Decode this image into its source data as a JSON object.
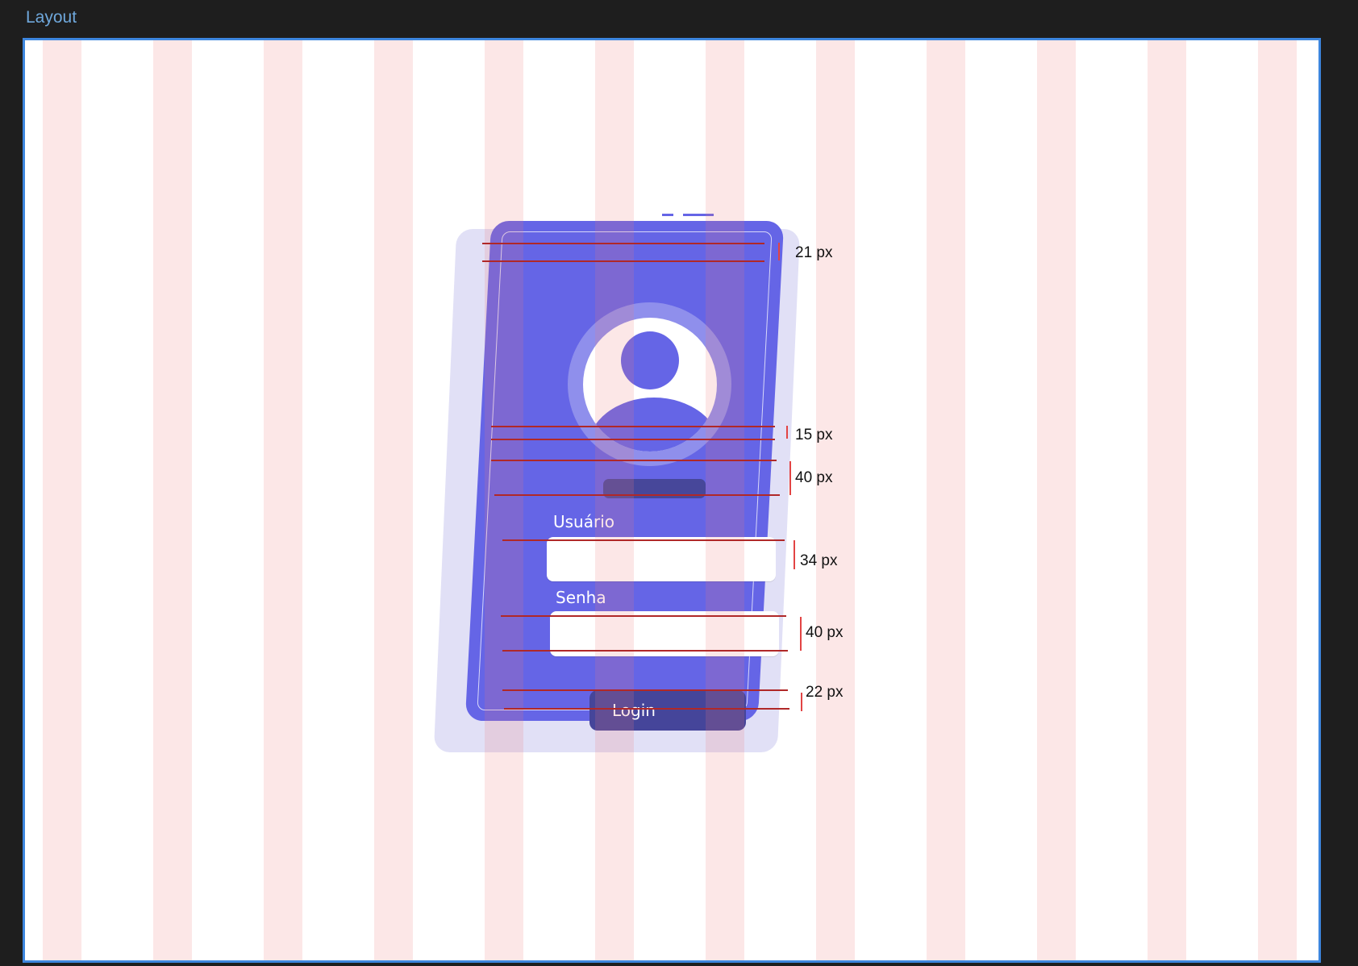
{
  "frame": {
    "title": "Layout"
  },
  "login_card": {
    "user_label": "Usuário",
    "password_label": "Senha",
    "login_label": "Login",
    "user_value": "",
    "password_value": ""
  },
  "measurements": [
    "21 px",
    "15 px",
    "40 px",
    "34 px",
    "40 px",
    "22 px"
  ],
  "colors": {
    "card": "#6565e6",
    "card_shadow": "#e1e0f6",
    "button": "#45459a",
    "grid_column": "#fbe3e3",
    "guide_line": "#b02828",
    "frame_border": "#3d86de"
  }
}
